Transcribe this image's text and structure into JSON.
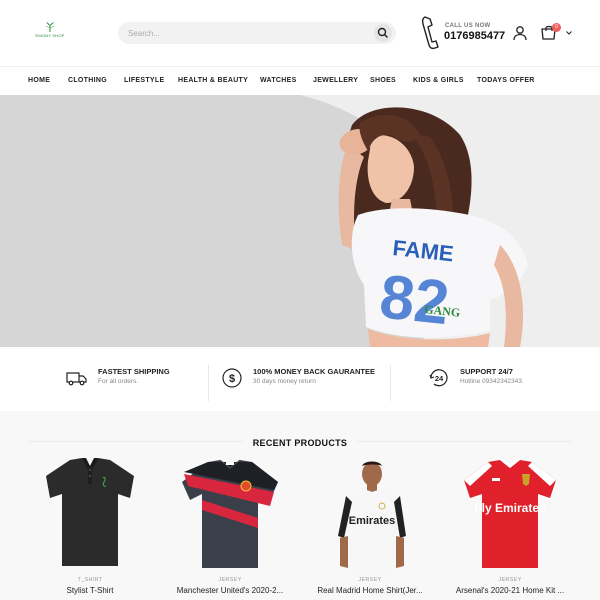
{
  "header": {
    "logo_text": "EMONY SHOP",
    "search_placeholder": "Search...",
    "call_label": "CALL US NOW",
    "call_number": "0176985477",
    "cart_count": "0"
  },
  "nav": {
    "items": [
      {
        "label": "HOME"
      },
      {
        "label": "CLOTHING"
      },
      {
        "label": "LIFESTYLE"
      },
      {
        "label": "HEALTH & BEAUTY"
      },
      {
        "label": "WATCHES"
      },
      {
        "label": "JEWELLERY"
      },
      {
        "label": "SHOES"
      },
      {
        "label": "KIDS & GIRLS"
      },
      {
        "label": "TODAYS OFFER"
      }
    ]
  },
  "hero": {
    "shirt_text_top": "FAME",
    "shirt_text_num": "82",
    "shirt_text_bottom": "GANG"
  },
  "features": [
    {
      "icon": "truck-icon",
      "title": "FASTEST SHIPPING",
      "subtitle": "For all orders."
    },
    {
      "icon": "dollar-icon",
      "title": "100% MONEY BACK GAURANTEE",
      "subtitle": "30 days money return"
    },
    {
      "icon": "support-24-icon",
      "title": "SUPPORT 24/7",
      "subtitle": "Hotline 09342342343."
    }
  ],
  "recent": {
    "title": "RECENT PRODUCTS",
    "products": [
      {
        "category": "T_SHIRT",
        "name": "Stylist T-Shirt"
      },
      {
        "category": "JERSEY",
        "name": "Manchester United's 2020-2..."
      },
      {
        "category": "JERSEY",
        "name": "Real Madrid Home Shirt(Jer..."
      },
      {
        "category": "JERSEY",
        "name": "Arsenal's 2020-21 Home Kit ..."
      }
    ],
    "jersey_sponsor_1": "Emirates",
    "jersey_sponsor_2": "Fly Emirates"
  },
  "colors": {
    "accent": "#f25c5c",
    "logo_green": "#2c8c3c",
    "hero_bg": "#dcdcdc"
  }
}
